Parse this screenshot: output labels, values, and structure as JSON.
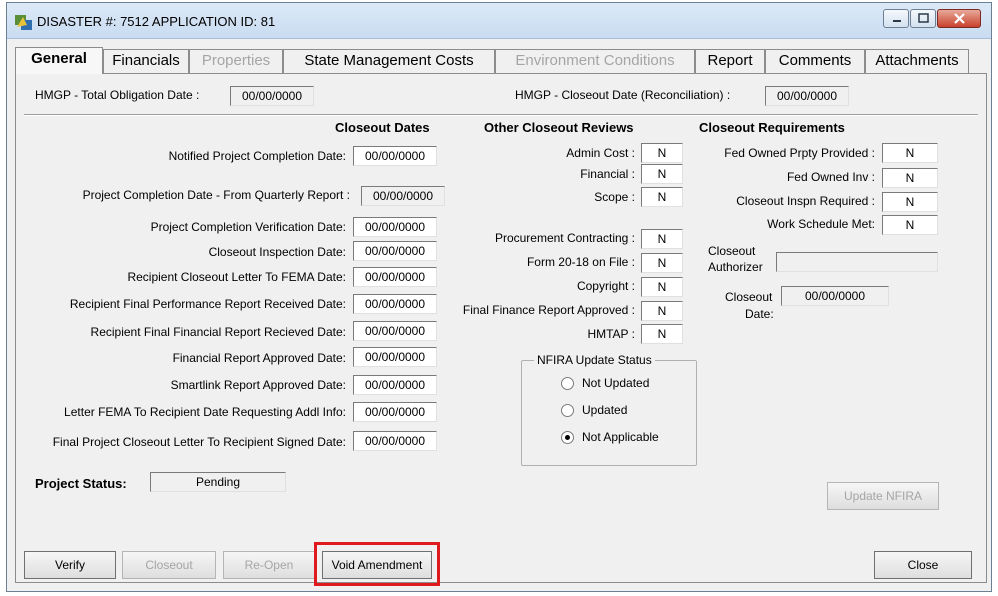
{
  "window": {
    "title": "DISASTER #: 7512  APPLICATION ID: 81"
  },
  "tabs": [
    {
      "label": "General",
      "state": "active"
    },
    {
      "label": "Financials",
      "state": "enabled"
    },
    {
      "label": "Properties",
      "state": "disabled"
    },
    {
      "label": "State Management Costs",
      "state": "enabled"
    },
    {
      "label": "Environment Conditions",
      "state": "disabled"
    },
    {
      "label": "Report",
      "state": "enabled"
    },
    {
      "label": "Comments",
      "state": "enabled"
    },
    {
      "label": "Attachments",
      "state": "enabled"
    }
  ],
  "header_fields": {
    "total_obligation_label": "HMGP - Total Obligation Date :",
    "total_obligation_value": "00/00/0000",
    "closeout_recon_label": "HMGP - Closeout Date (Reconciliation) :",
    "closeout_recon_value": "00/00/0000"
  },
  "closeout_dates": {
    "header": "Closeout Dates",
    "rows": [
      {
        "label": "Notified Project  Completion Date:",
        "value": "00/00/0000"
      },
      {
        "label": "Project Completion Date - From Quarterly Report :",
        "value": "00/00/0000"
      },
      {
        "label": "Project Completion Verification Date:",
        "value": "00/00/0000"
      },
      {
        "label": "Closeout Inspection Date:",
        "value": "00/00/0000"
      },
      {
        "label": "Recipient Closeout  Letter To FEMA Date:",
        "value": "00/00/0000"
      },
      {
        "label": "Recipient Final Performance Report Received  Date:",
        "value": "00/00/0000"
      },
      {
        "label": "Recipient Final Financial Report Recieved Date:",
        "value": "00/00/0000"
      },
      {
        "label": "Financial Report Approved Date:",
        "value": "00/00/0000"
      },
      {
        "label": "Smartlink Report Approved Date:",
        "value": "00/00/0000"
      },
      {
        "label": "Letter FEMA To Recipient Date Requesting Addl Info:",
        "value": "00/00/0000"
      },
      {
        "label": "Final Project Closeout Letter To Recipient Signed Date:",
        "value": "00/00/0000"
      }
    ]
  },
  "other_reviews": {
    "header": "Other Closeout Reviews",
    "rows": [
      {
        "label": "Admin Cost :",
        "value": "N"
      },
      {
        "label": "Financial :",
        "value": "N"
      },
      {
        "label": "Scope :",
        "value": "N"
      },
      {
        "label": "Procurement Contracting  :",
        "value": "N"
      },
      {
        "label": "Form 20-18 on File :",
        "value": "N"
      },
      {
        "label": "Copyright :",
        "value": "N"
      },
      {
        "label": "Final Finance Report Approved :",
        "value": "N"
      },
      {
        "label": "HMTAP :",
        "value": "N"
      }
    ]
  },
  "nfira": {
    "title": "NFIRA Update Status",
    "options": [
      "Not Updated",
      "Updated",
      "Not Applicable"
    ],
    "selected": "Not Applicable"
  },
  "requirements": {
    "header": "Closeout Requirements",
    "rows": [
      {
        "label": "Fed Owned Prpty Provided :",
        "value": "N"
      },
      {
        "label": "Fed Owned Inv :",
        "value": "N"
      },
      {
        "label": "Closeout Inspn Required :",
        "value": "N"
      },
      {
        "label": "Work Schedule Met:",
        "value": "N"
      }
    ],
    "authorizer_label_1": "Closeout",
    "authorizer_label_2": "Authorizer",
    "authorizer_value": "",
    "date_label_1": "Closeout",
    "date_label_2": "Date:",
    "date_value": "00/00/0000"
  },
  "status": {
    "label": "Project Status:",
    "value": "Pending"
  },
  "buttons": {
    "update_nfira": "Update NFIRA",
    "verify": "Verify",
    "closeout": "Closeout",
    "reopen": "Re-Open",
    "void_amendment": "Void Amendment",
    "close": "Close"
  },
  "colors": {
    "highlight": "#e0191f"
  },
  "icons": {
    "app": "disaster-app-icon",
    "minimize": "minimize-icon",
    "maximize": "maximize-icon",
    "close": "close-icon"
  }
}
